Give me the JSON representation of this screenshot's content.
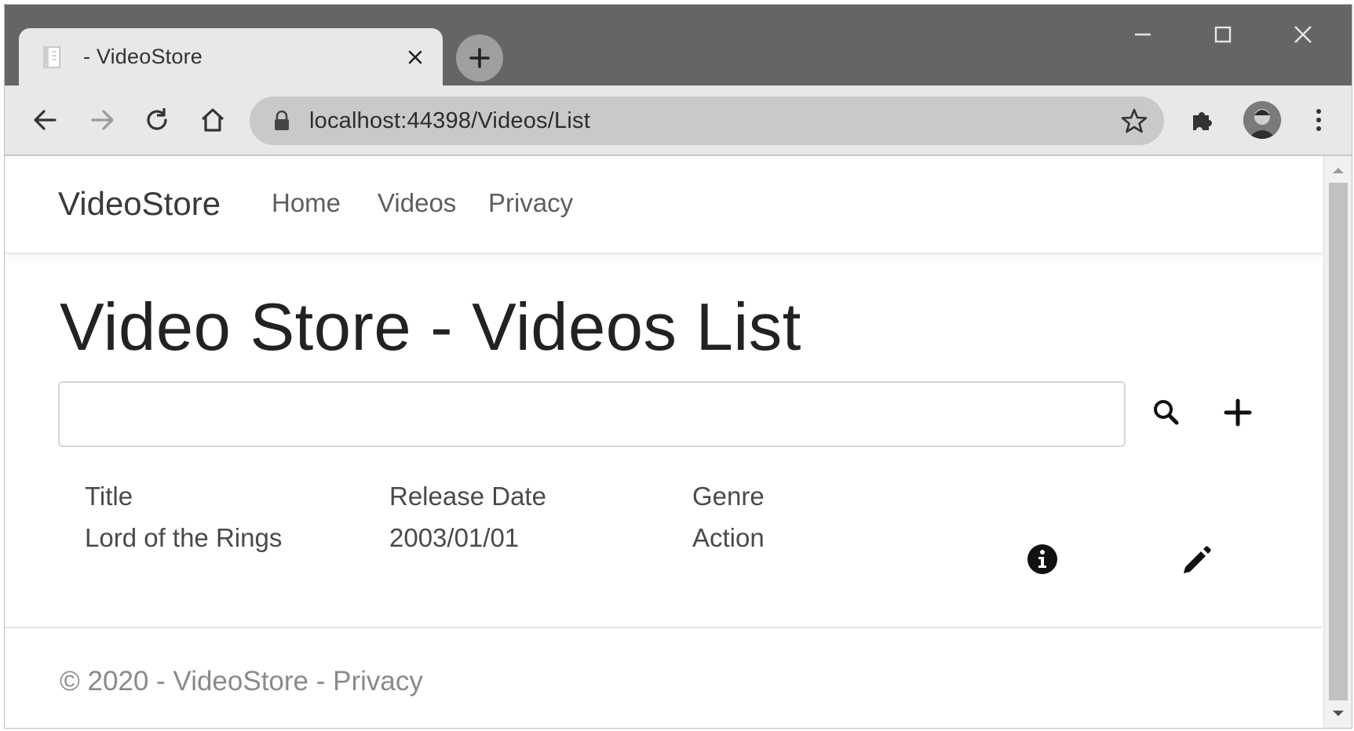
{
  "browser": {
    "tab": {
      "title": "- VideoStore",
      "favicon": "page-icon",
      "close_icon": "close-icon"
    },
    "new_tab_icon": "plus-icon",
    "window_controls": [
      "minimize-icon",
      "maximize-icon",
      "close-icon"
    ],
    "toolbar_icons": [
      "back-arrow-icon",
      "forward-arrow-icon",
      "reload-icon",
      "home-icon"
    ],
    "address_bar": {
      "url": "localhost:44398/Videos/List",
      "lock_icon": "lock-icon",
      "bookmark_icon": "star-icon"
    },
    "right_icons": [
      "extensions-puzzle-icon",
      "profile-avatar",
      "kebab-menu-icon"
    ]
  },
  "navbar": {
    "brand": "VideoStore",
    "links": [
      "Home",
      "Videos",
      "Privacy"
    ]
  },
  "main": {
    "title": "Video Store - Videos List",
    "search": {
      "value": "",
      "placeholder": ""
    },
    "search_icon": "search-icon",
    "add_icon": "plus-icon",
    "table": {
      "headers": [
        "Title",
        "Release Date",
        "Genre"
      ],
      "rows": [
        {
          "title": "Lord of the Rings",
          "release_date": "2003/01/01",
          "genre": "Action",
          "actions": [
            "info-circle-icon",
            "pencil-icon"
          ]
        }
      ]
    }
  },
  "footer": {
    "text": "© 2020 - VideoStore - Privacy"
  },
  "colors": {
    "tab_strip": "#656565",
    "toolbar": "#e8e8e8",
    "omnibox": "#c9c9c9",
    "page_bg": "#ffffff"
  }
}
